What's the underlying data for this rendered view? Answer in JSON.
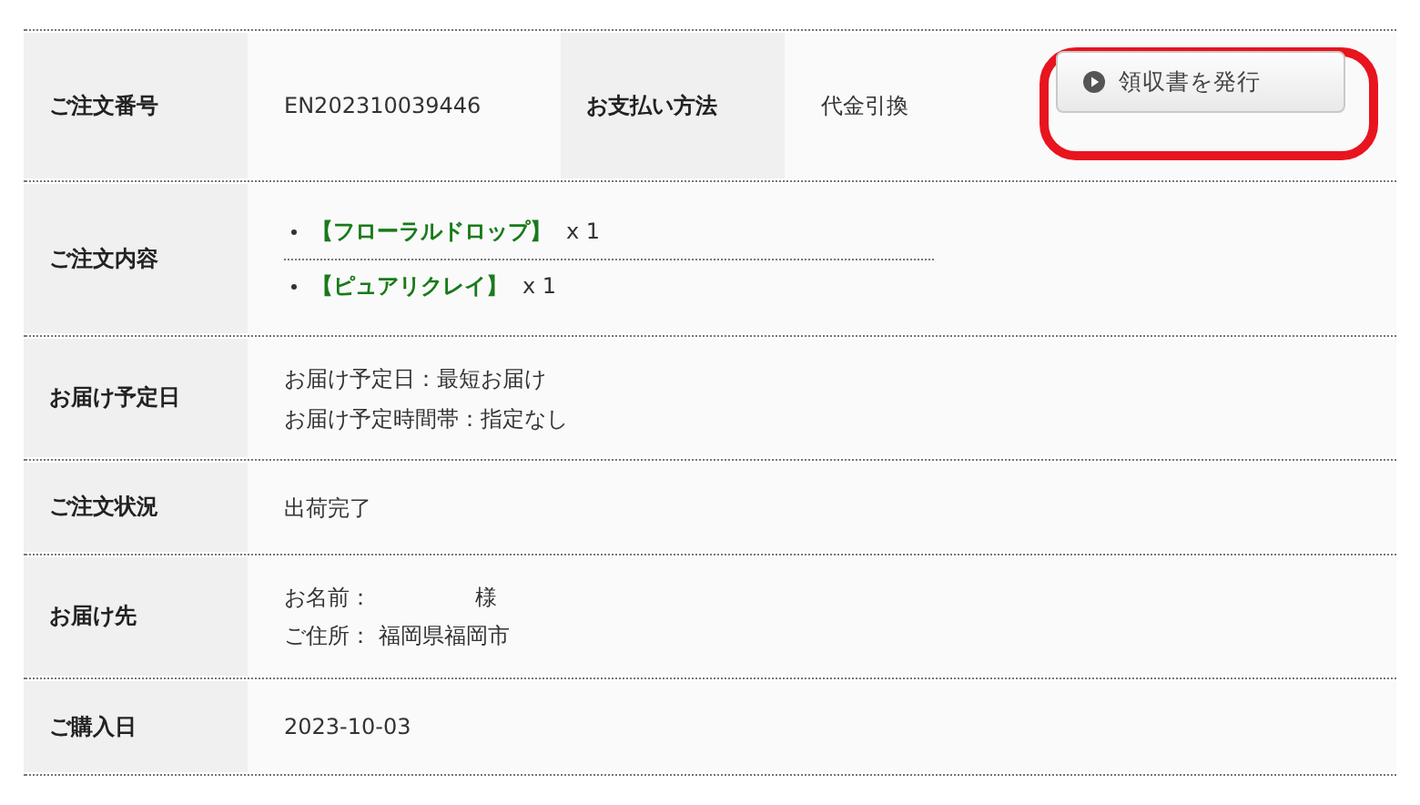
{
  "order_table": {
    "rows": [
      {
        "kind": "pair",
        "label": "ご注文番号",
        "value": "EN202310039446",
        "label_2": "お支払い方法",
        "value_2": "代金引換",
        "button": {
          "label": "領収書を発行",
          "highlighted": true
        }
      },
      {
        "kind": "items",
        "label": "ご注文内容",
        "items": [
          {
            "name": "【フローラルドロップ】",
            "quantity": "x 1"
          },
          {
            "name": "【ピュアリクレイ】",
            "quantity": "x 1"
          }
        ]
      },
      {
        "kind": "lines",
        "label": "お届け予定日",
        "lines": [
          "お届け予定日：最短お届け",
          "お届け予定時間帯：指定なし"
        ]
      },
      {
        "kind": "lines",
        "label": "ご注文状況",
        "lines": [
          "出荷完了"
        ]
      },
      {
        "kind": "address",
        "label": "お届け先",
        "name_label": "お名前：",
        "name_suffix": "様",
        "address_label": "ご住所：",
        "address": "福岡県福岡市"
      },
      {
        "kind": "lines",
        "label": "ご購入日",
        "lines": [
          "2023-10-03"
        ]
      }
    ]
  }
}
